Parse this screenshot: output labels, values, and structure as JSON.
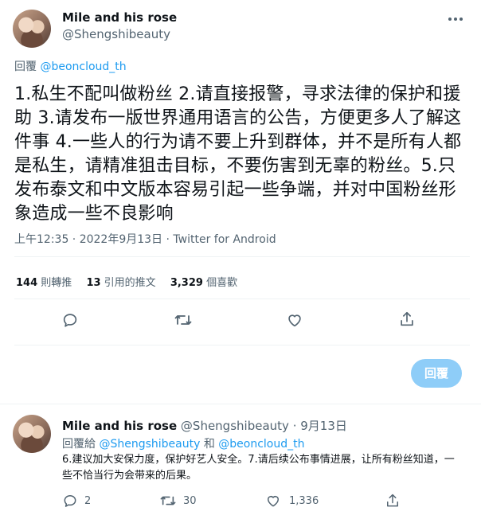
{
  "main_tweet": {
    "author_name": "Mile and his rose",
    "author_handle": "@Shengshibeauty",
    "reply_prefix": "回覆",
    "reply_to": "@beoncloud_th",
    "text": "1.私生不配叫做粉丝 2.请直接报警，寻求法律的保护和援助 3.请发布一版世界通用语言的公告，方便更多人了解这件事 4.一些人的行为请不要上升到群体，并不是所有人都是私生，请精准狙击目标，不要伤害到无辜的粉丝。5.只发布泰文和中文版本容易引起一些争端，并对中国粉丝形象造成一些不良影响",
    "meta": "上午12:35 · 2022年9月13日 · Twitter for Android",
    "retweets_count": "144",
    "retweets_label": "則轉推",
    "quotes_count": "13",
    "quotes_label": "引用的推文",
    "likes_count": "3,329",
    "likes_label": "個喜歡"
  },
  "reply_composer": {
    "button_label": "回覆"
  },
  "reply_tweet": {
    "author_name": "Mile and his rose",
    "author_handle": "@Shengshibeauty",
    "date": "9月13日",
    "reply_prefix": "回覆給",
    "reply_to_1": "@Shengshibeauty",
    "reply_and": "和",
    "reply_to_2": "@beoncloud_th",
    "text": "6.建议加大安保力度，保护好艺人安全。7.请后续公布事情进展，让所有粉丝知道，一些不恰当行为会带来的后果。",
    "replies": "2",
    "retweets": "30",
    "likes": "1,336"
  },
  "icons": [
    "more-icon",
    "reply-icon",
    "retweet-icon",
    "like-icon",
    "share-icon"
  ],
  "colors": {
    "link": "#1d9bf0",
    "muted": "#536471",
    "reply_button": "#8ecdf8"
  }
}
